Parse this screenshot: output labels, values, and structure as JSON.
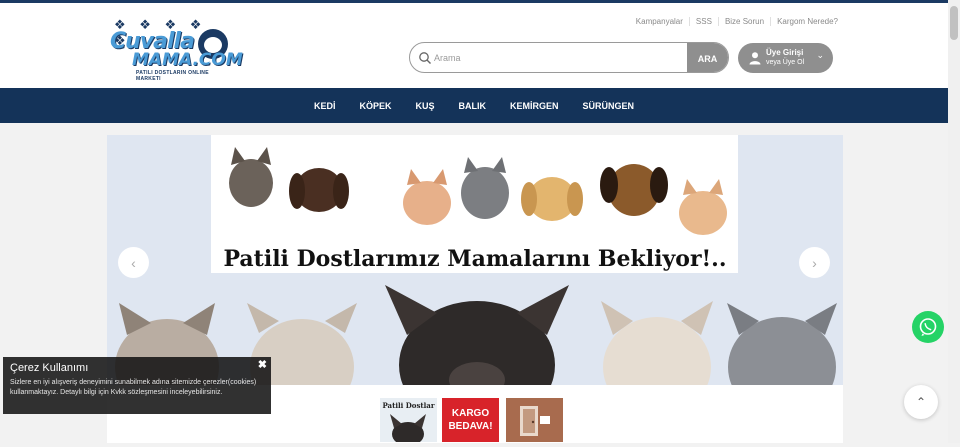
{
  "brand": {
    "line1": "Cuvalla",
    "line2": "MAMA.COM",
    "tagline": "PATILI DOSTLARIN ONLINE MARKETI",
    "colors": {
      "navy": "#143359",
      "blue": "#4a9bd6"
    }
  },
  "top_links": [
    "Kampanyalar",
    "SSS",
    "Bize Sorun",
    "Kargom Nerede?"
  ],
  "search": {
    "placeholder": "Arama",
    "button": "ARA"
  },
  "account": {
    "line1": "Üye Girişi",
    "line2": "veya Üye Ol"
  },
  "nav": [
    "KEDİ",
    "KÖPEK",
    "KUŞ",
    "BALIK",
    "KEMİRGEN",
    "SÜRÜNGEN"
  ],
  "slider": {
    "headline": "Patili Dostlarımız Mamalarını Bekliyor!.."
  },
  "badges": {
    "first": "Patili Dostlar",
    "second_line1": "KARGO",
    "second_line2": "BEDAVA!"
  },
  "cookie": {
    "title": "Çerez Kullanımı",
    "body": "Sizlere en iyi alışveriş deneyimini sunabilmek adına sitemizde çerezler(cookies) kullanmaktayız. Detaylı bilgi için Kvkk sözleşmesini inceleyebilirsiniz.",
    "close": "✖"
  },
  "controls": {
    "prev": "‹",
    "next": "›",
    "to_top": "⌃"
  }
}
